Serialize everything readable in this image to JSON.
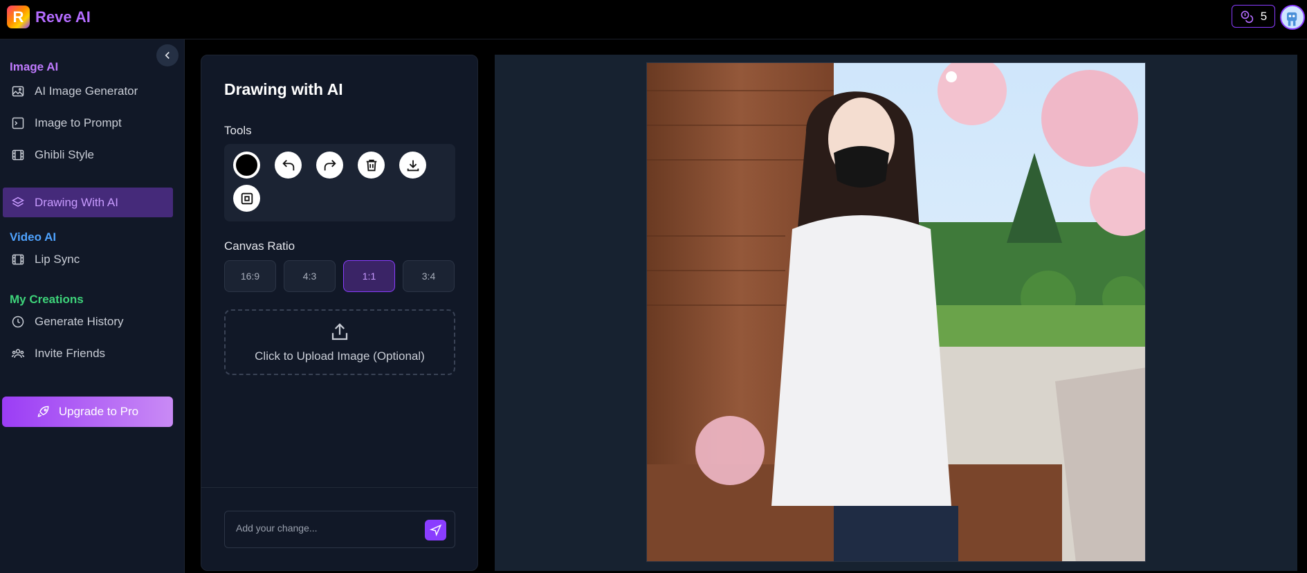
{
  "header": {
    "logo_letter": "R",
    "brand": "Reve AI",
    "credits": "5"
  },
  "sidebar": {
    "sections": [
      {
        "title": "Image AI",
        "color": "#c07bff"
      },
      {
        "title": "Video AI",
        "color": "#4fa3ff"
      },
      {
        "title": "My Creations",
        "color": "#3ed37a"
      }
    ],
    "items": [
      {
        "label": "AI Image Generator",
        "icon": "image-icon"
      },
      {
        "label": "Image to Prompt",
        "icon": "image-prompt-icon"
      },
      {
        "label": "Ghibli Style",
        "icon": "film-icon"
      },
      {
        "label": "Drawing With AI",
        "icon": "layers-icon",
        "active": true
      },
      {
        "label": "Lip Sync",
        "icon": "film-icon"
      },
      {
        "label": "Generate History",
        "icon": "clock-icon"
      },
      {
        "label": "Invite Friends",
        "icon": "users-icon"
      }
    ],
    "upgrade_label": "Upgrade to Pro"
  },
  "panel": {
    "title": "Drawing with AI",
    "tools_label": "Tools",
    "canvas_ratio_label": "Canvas Ratio",
    "ratios": [
      "16:9",
      "4:3",
      "1:1",
      "3:4"
    ],
    "selected_ratio": "1:1",
    "upload_label": "Click to Upload Image (Optional)",
    "change_placeholder": "Add your change..."
  },
  "colors": {
    "accent": "#8a3dff",
    "brand": "#b46cff"
  }
}
